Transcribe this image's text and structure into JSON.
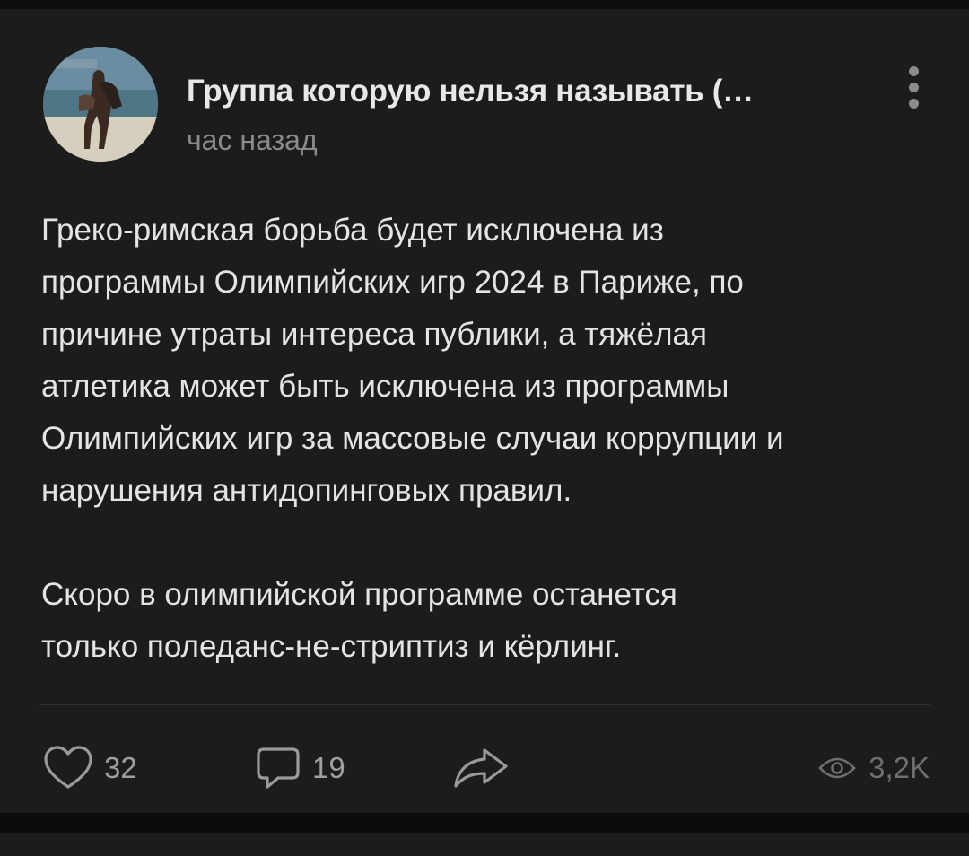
{
  "post": {
    "group_name": "Группа которую нельзя называть (…",
    "time": "час назад",
    "paragraphs": [
      [
        "Греко-римская борьба будет исключена из",
        "программы Олимпийских игр 2024 в Париже, по",
        "причине утраты интереса публики, а тяжёлая",
        "атлетика может быть исключена из программы",
        "Олимпийских игр за массовые случаи коррупции и",
        "нарушения антидопинговых правил."
      ],
      [
        "Скоро в олимпийской программе останется",
        "только поледанс-не-стриптиз и кёрлинг."
      ]
    ]
  },
  "actions": {
    "likes": "32",
    "comments": "19",
    "views": "3,2K"
  },
  "icons": {
    "like": "heart-icon",
    "comment": "comment-bubble-icon",
    "share": "share-arrow-icon",
    "views": "eye-icon",
    "menu": "more-vertical-icon"
  },
  "colors": {
    "background": "#1c1c1c",
    "text": "#e4e4e4",
    "secondary": "#8a8a8a"
  }
}
